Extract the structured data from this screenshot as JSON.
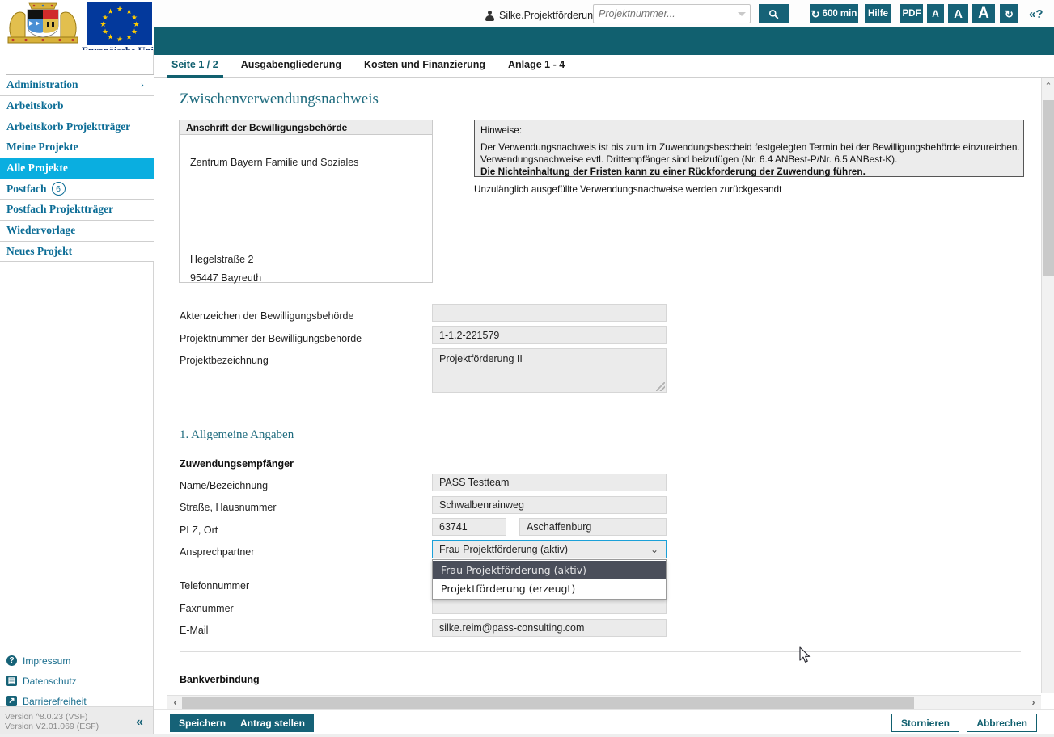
{
  "topbar": {
    "user_icon": "user-icon",
    "user_name": "Silke.Projektförderung",
    "search_placeholder": "Projektnummer...",
    "search_value": "",
    "search_icon": "search-icon",
    "buttons": {
      "timer": "600 min",
      "timer_icon": "refresh-icon",
      "hilfe": "Hilfe",
      "pdf": "PDF",
      "font_small": "A",
      "font_medium": "A",
      "font_large": "A",
      "refresh_icon": "refresh-icon",
      "collapse": "«?"
    }
  },
  "logos": {
    "eu_caption": "Europäische Uni"
  },
  "sidebar": {
    "items": [
      {
        "label": "Administration",
        "badge": "",
        "arrow": "›",
        "active": false
      },
      {
        "label": "Arbeitskorb",
        "badge": "",
        "arrow": "",
        "active": false
      },
      {
        "label": "Arbeitskorb Projektträger",
        "badge": "",
        "arrow": "",
        "active": false
      },
      {
        "label": "Meine Projekte",
        "badge": "",
        "arrow": "",
        "active": false
      },
      {
        "label": "Alle Projekte",
        "badge": "",
        "arrow": "",
        "active": true
      },
      {
        "label": "Postfach",
        "badge": "6",
        "arrow": "",
        "active": false
      },
      {
        "label": "Postfach Projektträger",
        "badge": "",
        "arrow": "",
        "active": false
      },
      {
        "label": "Wiedervorlage",
        "badge": "",
        "arrow": "",
        "active": false
      },
      {
        "label": "Neues Projekt",
        "badge": "",
        "arrow": "",
        "active": false
      }
    ],
    "footer_links": [
      {
        "label": "Impressum",
        "icon": "question-circle-icon",
        "glyph": "?"
      },
      {
        "label": "Datenschutz",
        "icon": "document-icon",
        "glyph": "▤"
      },
      {
        "label": "Barrierefreiheit",
        "icon": "accessibility-icon",
        "glyph": "↗"
      }
    ],
    "version_line_1": "Version ^8.0.23 (VSF)",
    "version_line_2": "Version V2.01.069 (ESF)",
    "collapse_icon": "«"
  },
  "tabs": [
    {
      "label": "Seite 1 / 2",
      "active": true
    },
    {
      "label": "Ausgabengliederung",
      "active": false
    },
    {
      "label": "Kosten und Finanzierung",
      "active": false
    },
    {
      "label": "Anlage 1 - 4",
      "active": false
    }
  ],
  "content": {
    "page_title": "Zwischenverwendungsnachweis",
    "address": {
      "legend": "Anschrift der Bewilligungsbehörde",
      "line1": "Zentrum Bayern Familie und Soziales",
      "street": "Hegelstraße 2",
      "city": "95447  Bayreuth"
    },
    "hinweise": {
      "title": "Hinweise:",
      "line1": "Der Verwendungsnachweis ist bis zum im Zuwendungsbescheid festgelegten Termin bei der Bewilligungsbehörde einzureichen.",
      "line2": "Verwendungsnachweise evtl. Drittempfänger sind beizufügen (Nr. 6.4 ANBest-P/Nr. 6.5 ANBest-K).",
      "line3": "Die Nichteinhaltung der Fristen kann zu einer Rückforderung der Zuwendung führen.",
      "extra": "Unzulänglich ausgefüllte Verwendungsnachweise werden zurückgesandt"
    },
    "fields": {
      "aktenzeichen_label": "Aktenzeichen der Bewilligungsbehörde",
      "aktenzeichen_value": "",
      "projektnummer_label": "Projektnummer der Bewilligungsbehörde",
      "projektnummer_value": "1-1.2-221579",
      "projektbezeichnung_label": "Projektbezeichnung",
      "projektbezeichnung_value": "Projektförderung II"
    },
    "section1_title": "1. Allgemeine Angaben",
    "subheading_zuwendungsempfaenger": "Zuwendungsempfänger",
    "recipient": {
      "name_label": "Name/Bezeichnung",
      "name_value": "PASS Testteam",
      "street_label": "Straße, Hausnummer",
      "street_value": "Schwalbenrainweg",
      "plz_ort_label": "PLZ, Ort",
      "plz_value": "63741",
      "ort_value": "Aschaffenburg",
      "ansprechpartner_label": "Ansprechpartner",
      "ansprechpartner_value": "Frau Projektförderung (aktiv)",
      "ansprechpartner_options": [
        {
          "label": "Frau Projektförderung (aktiv)",
          "selected": true
        },
        {
          "label": "Projektförderung (erzeugt)",
          "selected": false
        }
      ],
      "telefon_label": "Telefonnummer",
      "telefon_value": "",
      "fax_label": "Faxnummer",
      "fax_value": "",
      "email_label": "E-Mail",
      "email_value": "silke.reim@pass-consulting.com"
    },
    "subheading_bankverbindung": "Bankverbindung"
  },
  "actions": {
    "speichern": "Speichern",
    "antrag_stellen": "Antrag stellen",
    "stornieren": "Stornieren",
    "abbrechen": "Abbrechen"
  },
  "scrollbars": {
    "v_up": "⌃",
    "h_left": "‹",
    "h_right": "›"
  },
  "colors": {
    "teal": "#11606f",
    "teal_button": "#166277",
    "active_nav": "#0aaee0",
    "link": "#0c6d96",
    "dropdown_sel": "#4a4e5a"
  }
}
